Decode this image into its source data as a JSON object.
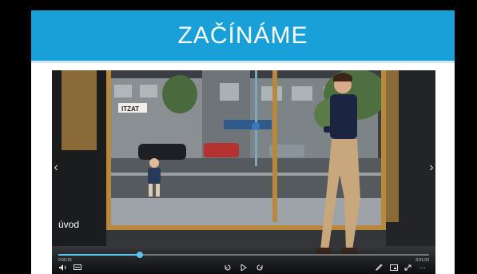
{
  "slide": {
    "title": "ZAČÍNÁME"
  },
  "video": {
    "caption": "úvod",
    "shop_sign": "ITZAT",
    "progress": 0.22,
    "time_current": "0:00:15",
    "time_total": "0:01:03",
    "controls": {
      "volume_icon": "volume-icon",
      "subtitles_icon": "subtitles-icon",
      "rewind_icon": "rewind-icon",
      "play_icon": "play-icon",
      "forward_icon": "forward-icon",
      "pen_icon": "pen-icon",
      "pip_icon": "picture-in-picture-icon",
      "fullscreen_icon": "fullscreen-icon",
      "more_icon": "more-icon"
    }
  },
  "colors": {
    "title_bar": "#1aa0d8",
    "progress": "#5cc2f0"
  }
}
